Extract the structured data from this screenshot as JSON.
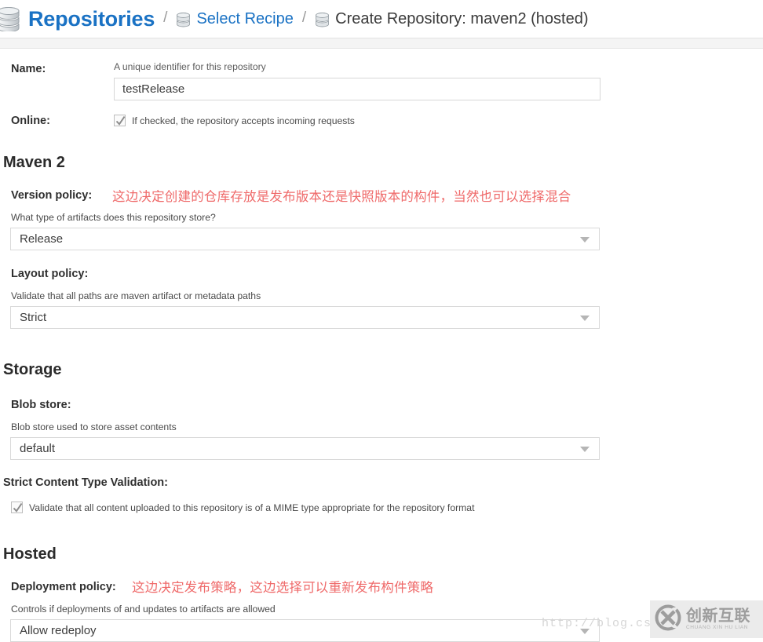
{
  "breadcrumb": {
    "root_label": "Repositories",
    "separator": "/",
    "recipe_label": "Select Recipe",
    "current_label": "Create Repository: maven2 (hosted)",
    "root_icon": "database-icon",
    "recipe_icon": "database-icon",
    "current_icon": "database-icon"
  },
  "form": {
    "name": {
      "label": "Name:",
      "hint": "A unique identifier for this repository",
      "value": "testRelease",
      "placeholder": ""
    },
    "online": {
      "label": "Online:",
      "checkbox_text": "If checked, the repository accepts incoming requests",
      "checked": true
    }
  },
  "maven2": {
    "title": "Maven 2",
    "version_policy": {
      "label": "Version policy:",
      "hint": "What type of artifacts does this repository store?",
      "value": "Release",
      "annotation": "这边决定创建的仓库存放是发布版本还是快照版本的构件，当然也可以选择混合"
    },
    "layout_policy": {
      "label": "Layout policy:",
      "hint": "Validate that all paths are maven artifact or metadata paths",
      "value": "Strict"
    }
  },
  "storage": {
    "title": "Storage",
    "blob_store": {
      "label": "Blob store:",
      "hint": "Blob store used to store asset contents",
      "value": "default"
    },
    "strict_content": {
      "label": "Strict Content Type Validation:",
      "checkbox_text": "Validate that all content uploaded to this repository is of a MIME type appropriate for the repository format",
      "checked": true
    }
  },
  "hosted": {
    "title": "Hosted",
    "deployment_policy": {
      "label": "Deployment policy:",
      "hint": "Controls if deployments of and updates to artifacts are allowed",
      "value": "Allow redeploy",
      "annotation": "这边决定发布策略，这边选择可以重新发布构件策略"
    }
  },
  "watermark": {
    "url": "http://blog.cs",
    "logo_cn": "创新互联",
    "logo_pinyin": "CHUANG XIN HU LIAN",
    "logo_mark": "cx-circle-logo"
  },
  "colors": {
    "link": "#1a72c4",
    "annotation": "#ef6a6a",
    "text": "#333333",
    "border": "#d9d9d9"
  }
}
